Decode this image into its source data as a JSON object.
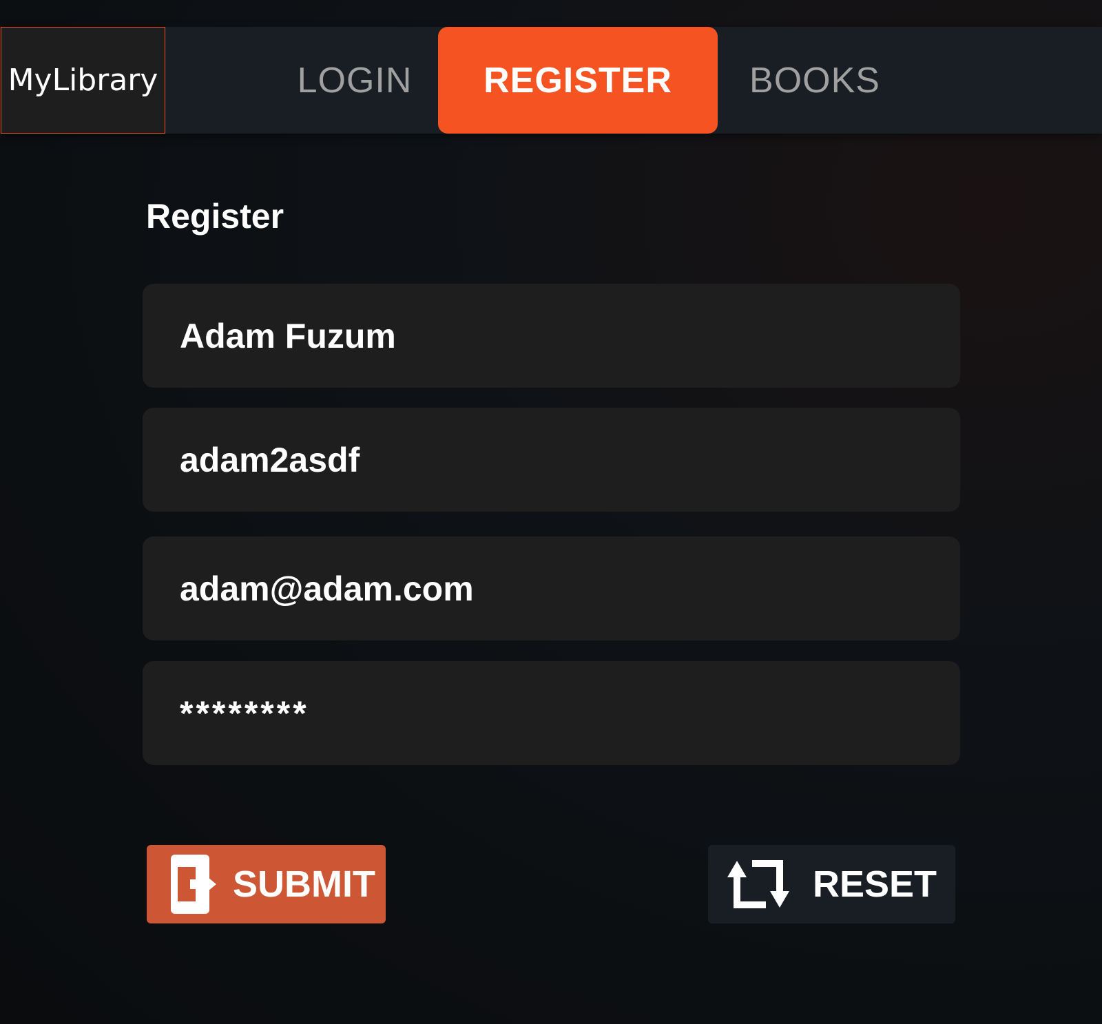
{
  "nav": {
    "brand": "MyLibrary",
    "tabs": [
      {
        "label": "LOGIN"
      },
      {
        "label": "REGISTER",
        "active": true
      },
      {
        "label": "BOOKS"
      }
    ]
  },
  "form": {
    "title": "Register",
    "fields": [
      {
        "name": "full-name",
        "value": "Adam Fuzum"
      },
      {
        "name": "username",
        "value": "adam2asdf"
      },
      {
        "name": "email",
        "value": "adam@adam.com"
      },
      {
        "name": "password",
        "value": "********"
      }
    ],
    "submit_label": "SUBMIT",
    "reset_label": "RESET"
  },
  "colors": {
    "accent": "#f55322",
    "submit": "#cd5735",
    "reset": "#181e24"
  },
  "icons": {
    "submit": "exit-door-icon",
    "reset": "repeat-arrows-icon"
  }
}
